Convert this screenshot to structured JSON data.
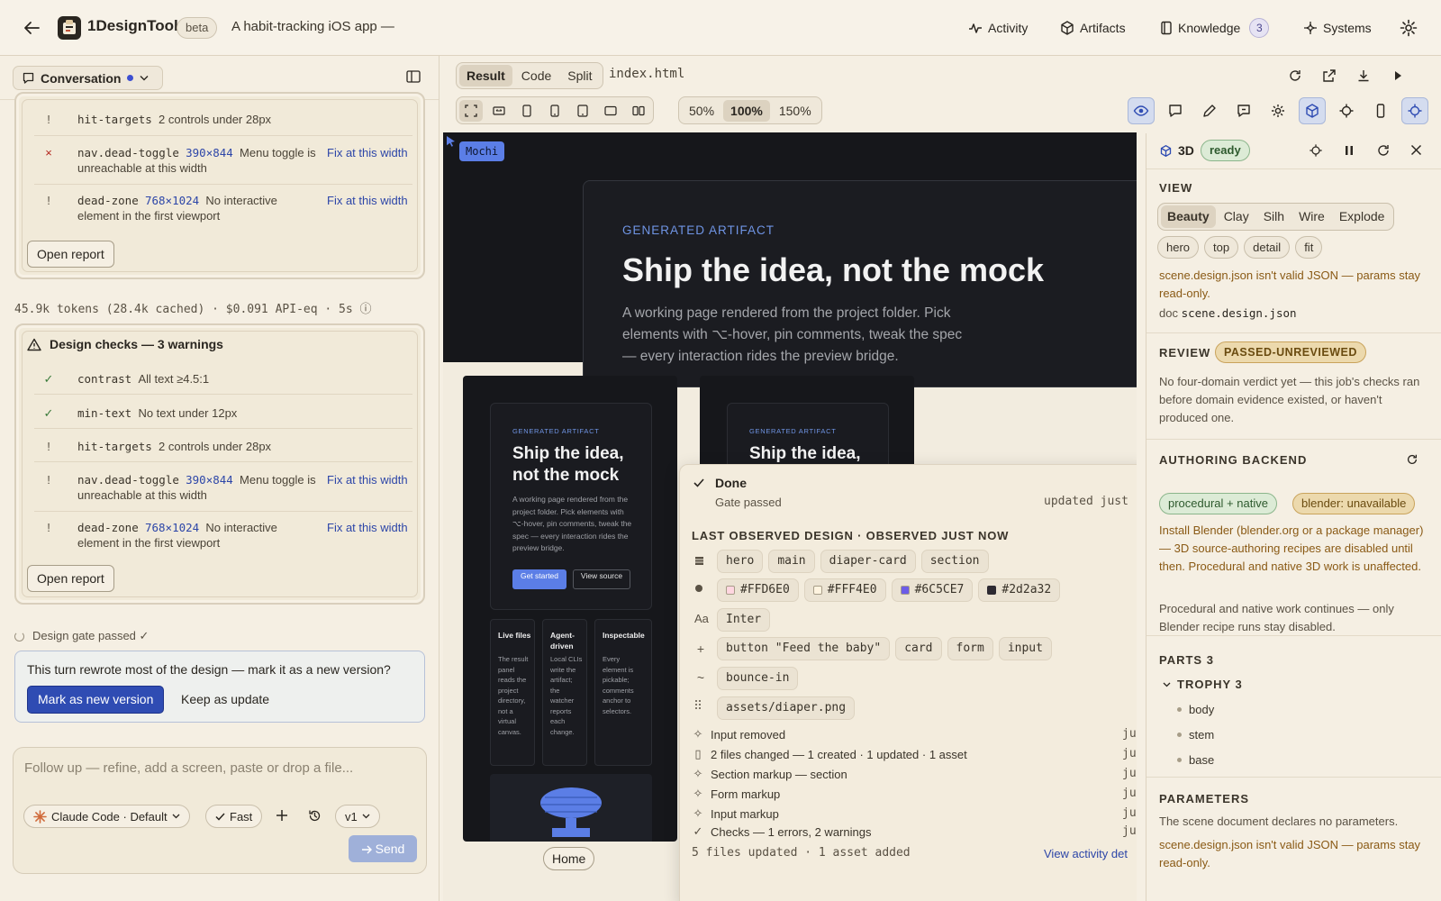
{
  "header": {
    "app_name": "1DesignTool",
    "badge": "beta",
    "project_title": "A habit-tracking iOS app —",
    "nav": {
      "activity": "Activity",
      "artifacts": "Artifacts",
      "knowledge": "Knowledge",
      "knowledge_count": "3",
      "systems": "Systems"
    },
    "icons": [
      "back-arrow-icon",
      "app-logo-icon",
      "activity-icon",
      "artifacts-icon",
      "knowledge-icon",
      "systems-icon",
      "gear-icon"
    ]
  },
  "left": {
    "conversation_tab": "Conversation",
    "top_card": {
      "rows": [
        {
          "sym": "!",
          "code": "hit-targets",
          "text": "2 controls under 28px"
        },
        {
          "sym": "×",
          "code": "nav.dead-toggle",
          "size": "390×844",
          "text": "Menu toggle is unreachable at this width",
          "fix": "Fix at this width"
        },
        {
          "sym": "!",
          "code": "dead-zone",
          "size": "768×1024",
          "text": "No interactive element in the first viewport",
          "fix": "Fix at this width"
        }
      ],
      "open_report": "Open report"
    },
    "tokens": "45.9k tokens (28.4k cached) · $0.091 API-eq · 5s ⓘ",
    "design_checks": {
      "title": "Design checks — 3 warnings",
      "rows": [
        {
          "sym": "✓",
          "code": "contrast",
          "text": "All text ≥4.5:1"
        },
        {
          "sym": "✓",
          "code": "min-text",
          "text": "No text under 12px"
        },
        {
          "sym": "!",
          "code": "hit-targets",
          "text": "2 controls under 28px"
        },
        {
          "sym": "!",
          "code": "nav.dead-toggle",
          "size": "390×844",
          "text": "Menu toggle is unreachable at this width",
          "fix": "Fix at this width"
        },
        {
          "sym": "!",
          "code": "dead-zone",
          "size": "768×1024",
          "text": "No interactive element in the first viewport",
          "fix": "Fix at this width"
        }
      ],
      "open_report": "Open report"
    },
    "gate": "Design gate passed ✓",
    "new_version": {
      "prompt": "This turn rewrote most of the design — mark it as a new version?",
      "mark_button": "Mark as new version",
      "keep_button": "Keep as update"
    },
    "composer": {
      "placeholder": "Follow up — refine, add a screen, paste or drop a file...",
      "model": "Claude Code · Default",
      "speed": "Fast",
      "version": "v1",
      "send": "Send"
    }
  },
  "center": {
    "view_tabs": [
      "Result",
      "Code",
      "Split"
    ],
    "active_view": "Result",
    "filename": "index.html",
    "zoom_options": [
      "50%",
      "100%",
      "150%"
    ],
    "active_zoom": "100%",
    "preview": {
      "cursor_label": "Mochi",
      "eyebrow": "GENERATED ARTIFACT",
      "title": "Ship the idea, not the mock",
      "body": "A working page rendered from the project folder. Pick elements with ⌥-hover, pin comments, tweak the spec — every interaction rides the preview bridge.",
      "phone_title": "Ship the idea, not the mock",
      "phone_title_2": "Ship the idea,",
      "phone_body": "A working page rendered from the project folder. Pick elements with ⌥-hover, pin comments, tweak the spec — every interaction rides the preview bridge.",
      "phone_btn_primary": "Get started",
      "phone_btn_secondary": "View source",
      "columns": [
        {
          "title": "Live files",
          "body": "The result panel reads the project directory, not a virtual canvas."
        },
        {
          "title": "Agent-driven",
          "body": "Local CLIs write the artifact; the watcher reports each change."
        },
        {
          "title": "Inspectable",
          "body": "Every element is pickable; comments anchor to selectors."
        }
      ],
      "home_label": "Home"
    },
    "popover": {
      "done": "Done",
      "gate": "Gate passed",
      "updated": "updated just",
      "section_label": "LAST OBSERVED DESIGN · OBSERVED JUST NOW",
      "structure": [
        "hero",
        "main",
        "diaper-card",
        "section"
      ],
      "colors": [
        {
          "hex": "#FFD6E0",
          "label": "#FFD6E0"
        },
        {
          "hex": "#FFF4E0",
          "label": "#FFF4E0"
        },
        {
          "hex": "#6C5CE7",
          "label": "#6C5CE7"
        },
        {
          "hex": "#2d2a32",
          "label": "#2d2a32"
        }
      ],
      "fonts": [
        "Inter"
      ],
      "font_icon": "Aa",
      "components": [
        "button \"Feed the baby\"",
        "card",
        "form",
        "input"
      ],
      "motion": [
        "bounce-in"
      ],
      "assets": [
        "assets/diaper.png"
      ],
      "activity": [
        {
          "icon": "✧",
          "text": "Input removed",
          "time": "ju"
        },
        {
          "icon": "▯",
          "text": "2 files changed — 1 created · 1 updated · 1 asset",
          "time": "ju"
        },
        {
          "icon": "✧",
          "text": "Section markup — section",
          "time": "ju"
        },
        {
          "icon": "✧",
          "text": "Form markup",
          "time": "ju"
        },
        {
          "icon": "✧",
          "text": "Input markup",
          "time": "ju"
        },
        {
          "icon": "✓",
          "text": "Checks — 1 errors, 2 warnings",
          "time": "ju"
        }
      ],
      "footer": "5 files updated · 1 asset added",
      "view_link": "View activity det"
    }
  },
  "right": {
    "title": "3D",
    "status": "ready",
    "view_label": "VIEW",
    "view_modes": [
      "Beauty",
      "Clay",
      "Silh",
      "Wire",
      "Explode"
    ],
    "active_mode": "Beauty",
    "camera_presets": [
      "hero",
      "top",
      "detail",
      "fit"
    ],
    "view_warning": "scene.design.json isn't valid JSON — params stay read-only.",
    "doc_prefix": "doc",
    "doc_file": "scene.design.json",
    "review_label": "REVIEW",
    "review_status": "PASSED-UNREVIEWED",
    "review_text": "No four-domain verdict yet — this job's checks ran before domain evidence existed, or haven't produced one.",
    "backend_label": "AUTHORING BACKEND",
    "backend_proc": "procedural + native",
    "backend_blender": "blender: unavailable",
    "backend_warning": "Install Blender (blender.org or a package manager) — 3D source-authoring recipes are disabled until then. Procedural and native 3D work is unaffected.",
    "backend_note": "Procedural and native work continues — only Blender recipe runs stay disabled.",
    "parts_label": "PARTS 3",
    "group_label": "TROPHY 3",
    "parts": [
      "body",
      "stem",
      "base"
    ],
    "params_label": "PARAMETERS",
    "params_text": "The scene document declares no parameters.",
    "params_warning": "scene.design.json isn't valid JSON — params stay read-only."
  },
  "colors": {
    "accent": "#2f4cb3",
    "link": "#2d46a8",
    "warning": "#8a5a15",
    "success_bg": "#dcebd6",
    "preview_bg": "#16171b",
    "preview_accent": "#5b7ee6"
  }
}
